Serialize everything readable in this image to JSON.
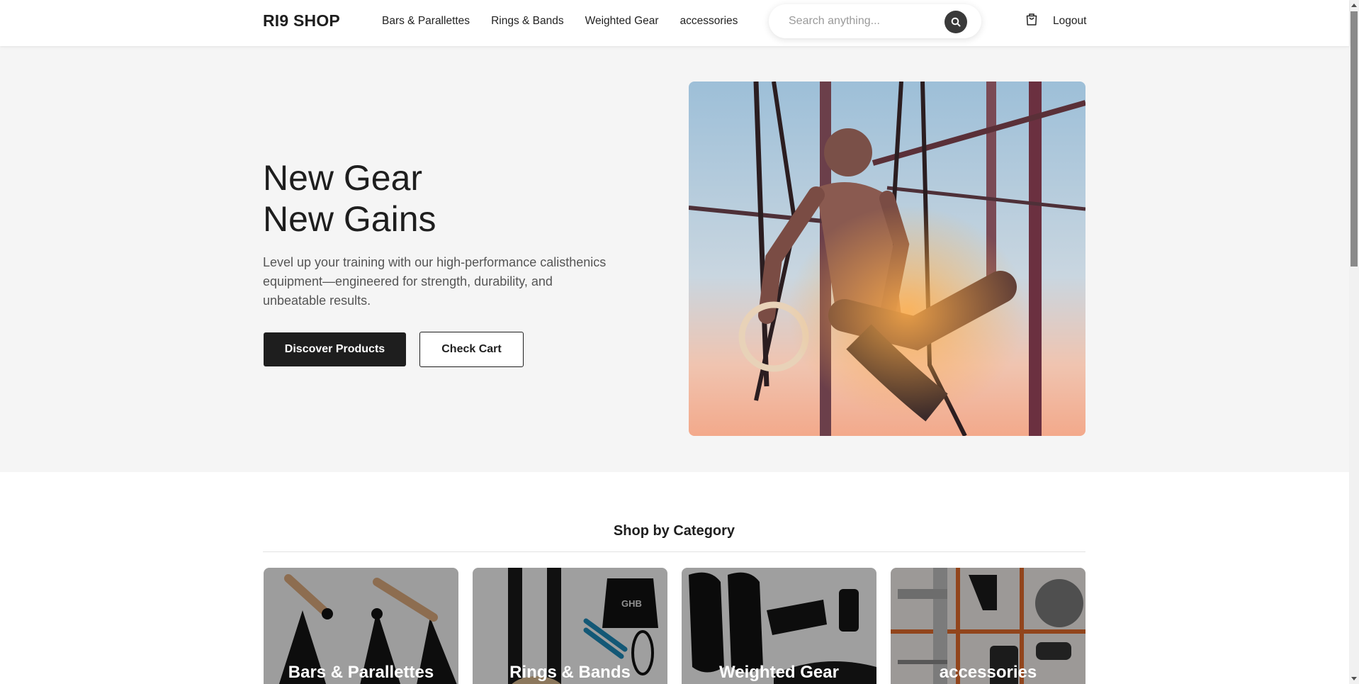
{
  "header": {
    "logo": "RI9 SHOP",
    "nav": [
      "Bars & Parallettes",
      "Rings & Bands",
      "Weighted Gear",
      "accessories"
    ],
    "search_placeholder": "Search anything...",
    "logout": "Logout"
  },
  "hero": {
    "title_line1": "New Gear",
    "title_line2": "New Gains",
    "description": "Level up your training with our high-performance calisthenics equipment—engineered for strength, durability, and unbeatable results.",
    "primary_button": "Discover Products",
    "secondary_button": "Check Cart"
  },
  "categories": {
    "title": "Shop by Category",
    "items": [
      "Bars & Parallettes",
      "Rings & Bands",
      "Weighted Gear",
      "accessories"
    ]
  },
  "colors": {
    "primary": "#1e1e1e",
    "hero_bg": "#f5f5f5",
    "sky": "#a9c6da",
    "sunset": "#f2b38d"
  }
}
